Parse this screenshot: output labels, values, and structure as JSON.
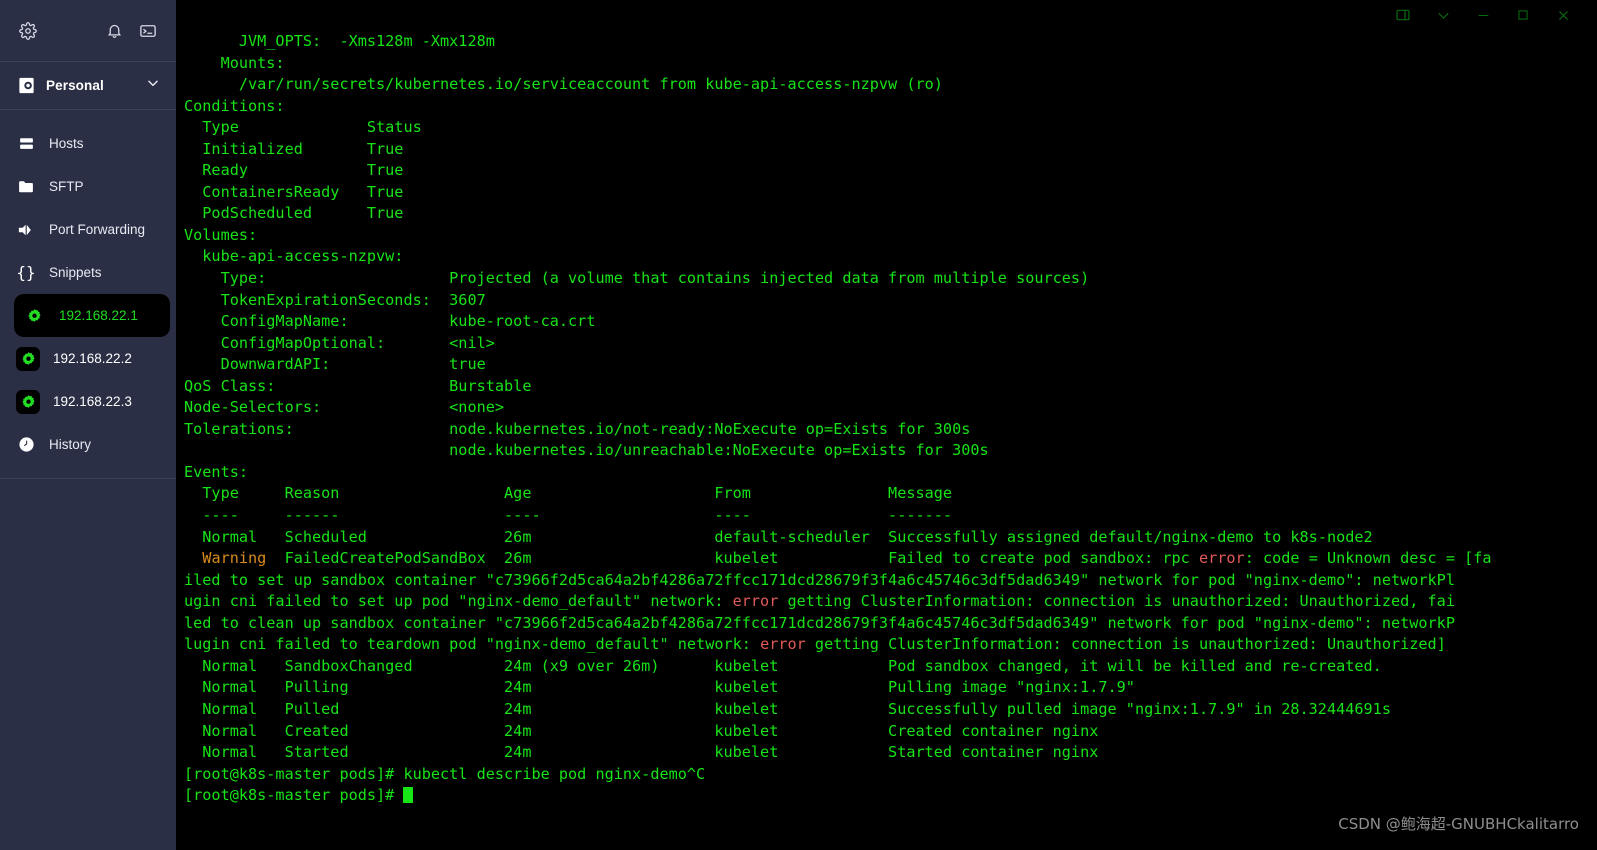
{
  "sidebar": {
    "topbar": {
      "settings_icon": "gear-icon",
      "notifications_icon": "bell-icon",
      "terminal_icon": "terminal-icon"
    },
    "account": {
      "label": "Personal",
      "vault_icon": "vault-icon",
      "chevron_icon": "chevron-down-icon"
    },
    "nav_items": [
      {
        "label": "Hosts",
        "icon": "server-rack-icon"
      },
      {
        "label": "SFTP",
        "icon": "folder-icon"
      },
      {
        "label": "Port Forwarding",
        "icon": "port-forwarding-icon"
      },
      {
        "label": "Snippets",
        "icon": "braces-icon"
      }
    ],
    "hosts": [
      {
        "label": "192.168.22.1",
        "icon": "host-gear-icon",
        "active": true
      },
      {
        "label": "192.168.22.2",
        "icon": "host-gear-icon",
        "active": false
      },
      {
        "label": "192.168.22.3",
        "icon": "host-gear-icon",
        "active": false
      }
    ],
    "history_item": {
      "label": "History",
      "icon": "clock-icon"
    }
  },
  "window_controls": {
    "panel_toggle": "split-panel-icon",
    "chevron": "chevron-down-icon",
    "minimize": "minimize-icon",
    "maximize": "maximize-icon",
    "close": "close-icon"
  },
  "terminal": {
    "colors": {
      "background": "#000000",
      "foreground": "#17e317",
      "warning": "#d98a1c",
      "error": "#e05a5a"
    },
    "lines": [
      "      JVM_OPTS:  -Xms128m -Xmx128m",
      "    Mounts:",
      "      /var/run/secrets/kubernetes.io/serviceaccount from kube-api-access-nzpvw (ro)",
      "Conditions:",
      "  Type              Status",
      "  Initialized       True",
      "  Ready             True",
      "  ContainersReady   True",
      "  PodScheduled      True",
      "Volumes:",
      "  kube-api-access-nzpvw:",
      "    Type:                    Projected (a volume that contains injected data from multiple sources)",
      "    TokenExpirationSeconds:  3607",
      "    ConfigMapName:           kube-root-ca.crt",
      "    ConfigMapOptional:       <nil>",
      "    DownwardAPI:             true",
      "QoS Class:                   Burstable",
      "Node-Selectors:              <none>",
      "Tolerations:                 node.kubernetes.io/not-ready:NoExecute op=Exists for 300s",
      "                             node.kubernetes.io/unreachable:NoExecute op=Exists for 300s",
      "Events:",
      "  Type     Reason                  Age                    From               Message",
      "  ----     ------                  ----                   ----               -------"
    ],
    "event_scheduled": {
      "type": "Normal",
      "rest": "   Scheduled               26m                    default-scheduler  Successfully assigned default/nginx-demo to k8s-node2"
    },
    "event_warning": {
      "type": "Warning",
      "pre": "  ",
      "mid": "  FailedCreatePodSandBox  26m                    kubelet            Failed to create pod sandbox: rpc ",
      "err": "error",
      "post": ": code = Unknown desc = [fa"
    },
    "wrapped_lines": [
      {
        "segments": [
          {
            "text": "iled to set up sandbox container \"c73966f2d5ca64a2bf4286a72ffcc171dcd28679f3f4a6c45746c3df5dad6349\" network for pod \"nginx-demo\": networkPl",
            "color": "green"
          }
        ]
      },
      {
        "segments": [
          {
            "text": "ugin cni failed to set up pod \"nginx-demo_default\" network: ",
            "color": "green"
          },
          {
            "text": "error",
            "color": "red"
          },
          {
            "text": " getting ClusterInformation: connection is unauthorized: Unauthorized, fai",
            "color": "green"
          }
        ]
      },
      {
        "segments": [
          {
            "text": "led to clean up sandbox container \"c73966f2d5ca64a2bf4286a72ffcc171dcd28679f3f4a6c45746c3df5dad6349\" network for pod \"nginx-demo\": networkP",
            "color": "green"
          }
        ]
      },
      {
        "segments": [
          {
            "text": "lugin cni failed to teardown pod \"nginx-demo_default\" network: ",
            "color": "green"
          },
          {
            "text": "error",
            "color": "red"
          },
          {
            "text": " getting ClusterInformation: connection is unauthorized: Unauthorized]",
            "color": "green"
          }
        ]
      }
    ],
    "tail_lines": [
      "  Normal   SandboxChanged          24m (x9 over 26m)      kubelet            Pod sandbox changed, it will be killed and re-created.",
      "  Normal   Pulling                 24m                    kubelet            Pulling image \"nginx:1.7.9\"",
      "  Normal   Pulled                  24m                    kubelet            Successfully pulled image \"nginx:1.7.9\" in 28.32444691s",
      "  Normal   Created                 24m                    kubelet            Created container nginx",
      "  Normal   Started                 24m                    kubelet            Started container nginx",
      "[root@k8s-master pods]# kubectl describe pod nginx-demo^C"
    ],
    "prompt": "[root@k8s-master pods]# "
  },
  "watermark": "CSDN @鲍海超-GNUBHCkalitarro"
}
